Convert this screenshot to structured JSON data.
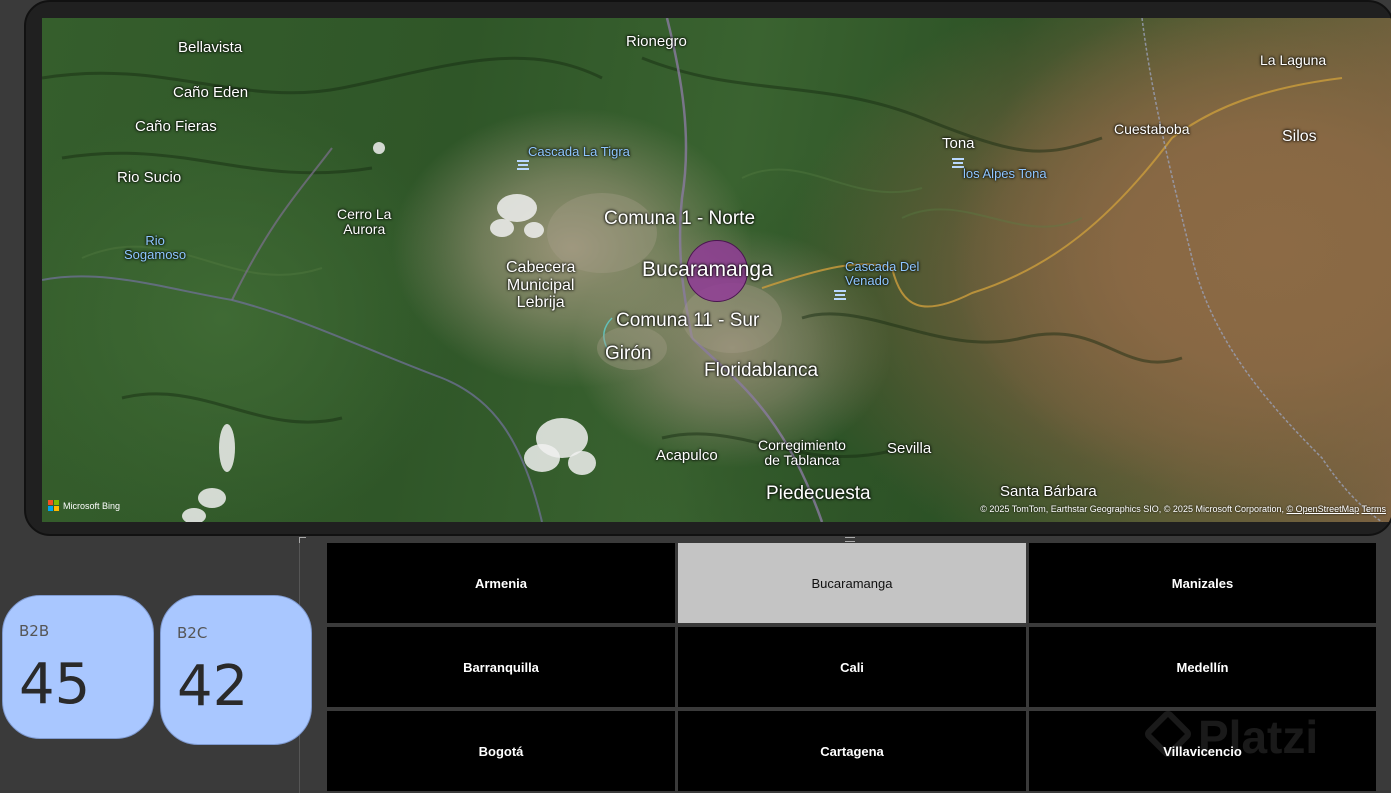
{
  "map": {
    "labels": {
      "bellavista": "Bellavista",
      "cano_eden": "Caño Eden",
      "cano_fieras": "Caño Fieras",
      "rio_sucio": "Rio Sucio",
      "rio_sogamoso": "Rio\nSogamoso",
      "cerro_la_aurora": "Cerro La\nAurora",
      "rionegro": "Rionegro",
      "cascada_la_tigra": "Cascada La Tigra",
      "comuna_1": "Comuna 1 - Norte",
      "cabecera_lebrija": "Cabecera\nMunicipal\nLebrija",
      "bucaramanga": "Bucaramanga",
      "comuna_11": "Comuna 11 - Sur",
      "giron": "Girón",
      "floridablanca": "Floridablanca",
      "acapulco": "Acapulco",
      "corregimiento_tablanca": "Corregimiento\nde Tablanca",
      "sevilla": "Sevilla",
      "piedecuesta": "Piedecuesta",
      "santa_barbara": "Santa Bárbara",
      "tona": "Tona",
      "los_alpes_tona": "los Alpes Tona",
      "cascada_del_venado": "Cascada Del\nVenado",
      "cuestaboba": "Cuestaboba",
      "silos": "Silos",
      "la_laguna": "La Laguna"
    },
    "bing_label": "Microsoft Bing",
    "attribution_text": "© 2025 TomTom, Earthstar Geographics SIO, © 2025 Microsoft Corporation, ",
    "attribution_osm": "© OpenStreetMap",
    "attribution_terms": "Terms",
    "bubble_color": "#913c96"
  },
  "kpis": [
    {
      "label": "B2B",
      "value": "45"
    },
    {
      "label": "B2C",
      "value": "42"
    }
  ],
  "slicer": {
    "selected": "Bucaramanga",
    "cities": [
      "Armenia",
      "Bucaramanga",
      "Manizales",
      "Barranquilla",
      "Cali",
      "Medellín",
      "Bogotá",
      "Cartagena",
      "Villavicencio"
    ]
  },
  "watermark": "Platzi",
  "colors": {
    "kpi_bg": "#a9c7ff",
    "tile_bg": "#000000",
    "tile_selected_bg": "#c4c4c4",
    "page_bg": "#3a3a3a"
  }
}
